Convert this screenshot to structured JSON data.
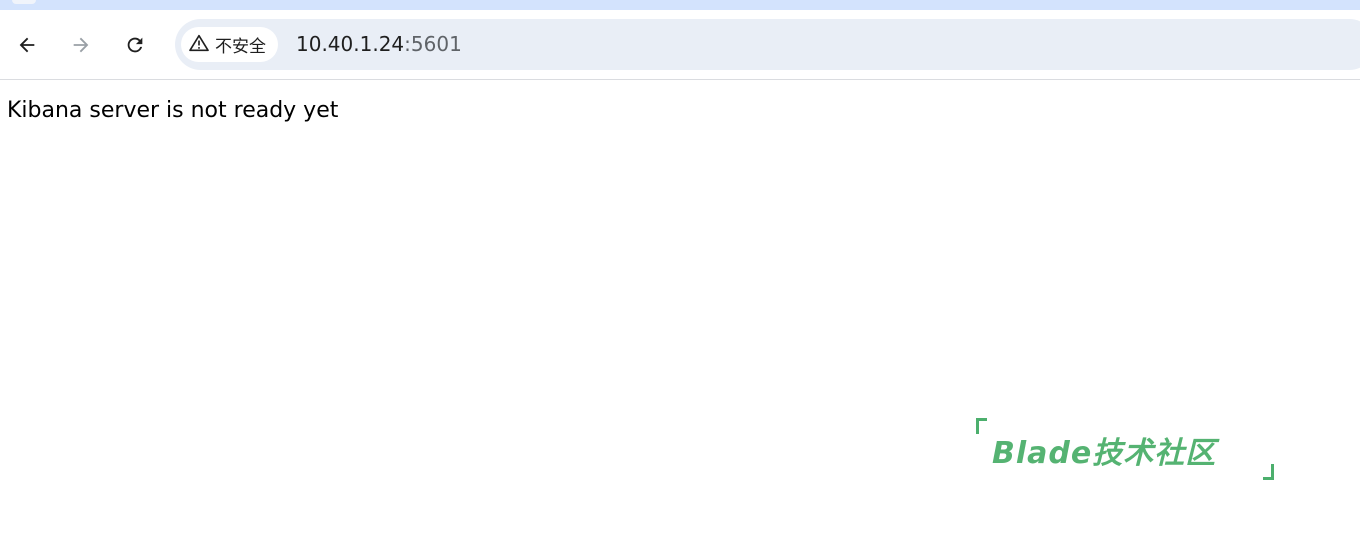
{
  "browser": {
    "nav": {
      "back_icon": "arrow-left-icon",
      "forward_icon": "arrow-right-icon",
      "reload_icon": "reload-icon"
    },
    "omnibox": {
      "security_icon": "warning-triangle-icon",
      "security_label": "不安全",
      "url_host": "10.40.1.24",
      "url_port": ":5601"
    }
  },
  "page": {
    "message": "Kibana server is not ready yet"
  },
  "watermark": {
    "text": "Blade技术社区",
    "color": "#55b372"
  }
}
